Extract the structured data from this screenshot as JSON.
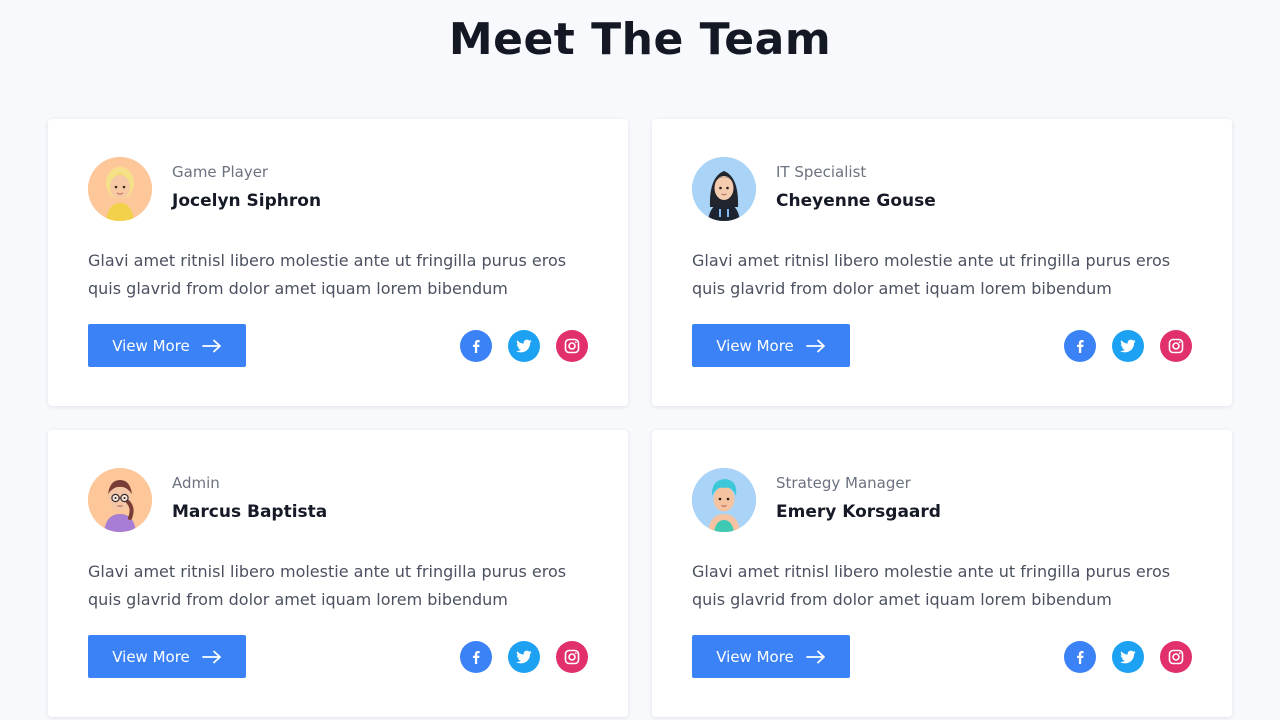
{
  "page": {
    "title": "Meet The Team"
  },
  "colors": {
    "background": "#f7f9fc",
    "card": "#ffffff",
    "button": "#3b82f6",
    "facebook": "#3b82f6",
    "twitter": "#1da1f2",
    "instagram": "#e1306c"
  },
  "members": [
    {
      "role": "Game Player",
      "name": "Jocelyn Siphron",
      "bio": "Glavi amet ritnisl libero molestie ante ut fringilla purus eros quis glavrid from dolor amet iquam lorem bibendum",
      "button_label": "View More",
      "avatar_icon": "avatar-blonde-woman",
      "avatar_bg": "#fdc79a"
    },
    {
      "role": "IT Specialist",
      "name": "Cheyenne Gouse",
      "bio": "Glavi amet ritnisl libero molestie ante ut fringilla purus eros quis glavrid from dolor amet iquam lorem bibendum",
      "button_label": "View More",
      "avatar_icon": "avatar-dark-hair-woman",
      "avatar_bg": "#a9d3f7"
    },
    {
      "role": "Admin",
      "name": "Marcus Baptista",
      "bio": "Glavi amet ritnisl libero molestie ante ut fringilla purus eros quis glavrid from dolor amet iquam lorem bibendum",
      "button_label": "View More",
      "avatar_icon": "avatar-glasses-person",
      "avatar_bg": "#fdc79a"
    },
    {
      "role": "Strategy Manager",
      "name": "Emery Korsgaard",
      "bio": "Glavi amet ritnisl libero molestie ante ut fringilla purus eros quis glavrid from dolor amet iquam lorem bibendum",
      "button_label": "View More",
      "avatar_icon": "avatar-teal-hair-man",
      "avatar_bg": "#a9d3f7"
    }
  ],
  "social_icons": [
    "facebook-icon",
    "twitter-icon",
    "instagram-icon"
  ]
}
